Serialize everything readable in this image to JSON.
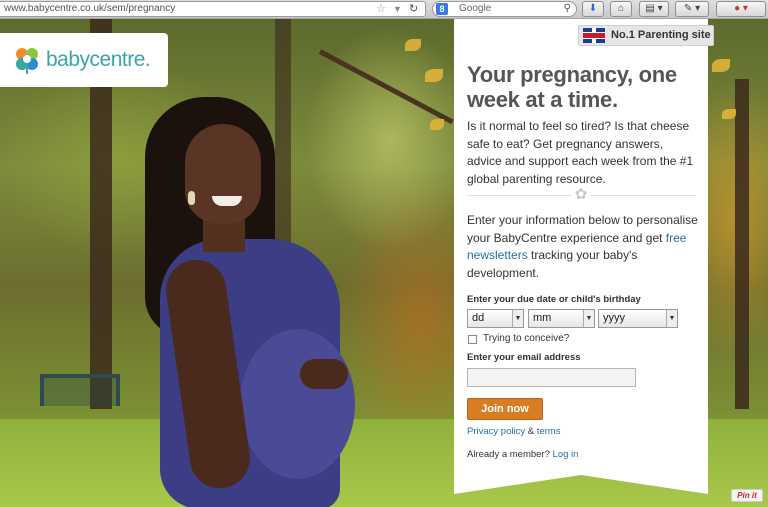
{
  "browser": {
    "url": "www.babycentre.co.uk/sem/pregnancy",
    "search_engine_badge": "8",
    "search_placeholder": "Google"
  },
  "brand": {
    "logo_text": "babycentre.",
    "accent": "#3aa6a2"
  },
  "badge": {
    "text": "No.1 Parenting site"
  },
  "panel": {
    "headline": "Your pregnancy, one week at a time.",
    "intro": "Is it normal to feel so tired? Is that cheese safe to eat? Get pregnancy answers, advice and support each week from the #1 global parenting resource.",
    "personalise_before": "Enter your information below to personalise your BabyCentre experience and get ",
    "personalise_link": "free newsletters",
    "personalise_after": " tracking your baby's development."
  },
  "form": {
    "due_date_label": "Enter your due date or child's birthday",
    "day_value": "dd",
    "month_value": "mm",
    "year_value": "yyyy",
    "conceive_label": "Trying to conceive?",
    "conceive_checked": false,
    "email_label": "Enter your email address",
    "email_value": "",
    "join_label": "Join now",
    "button_color": "#d97d22"
  },
  "footer": {
    "privacy_label": "Privacy policy",
    "amp": " & ",
    "terms_label": "terms",
    "member_text": "Already a member? ",
    "login_label": "Log in"
  },
  "pinit": {
    "label": "Pin it"
  }
}
